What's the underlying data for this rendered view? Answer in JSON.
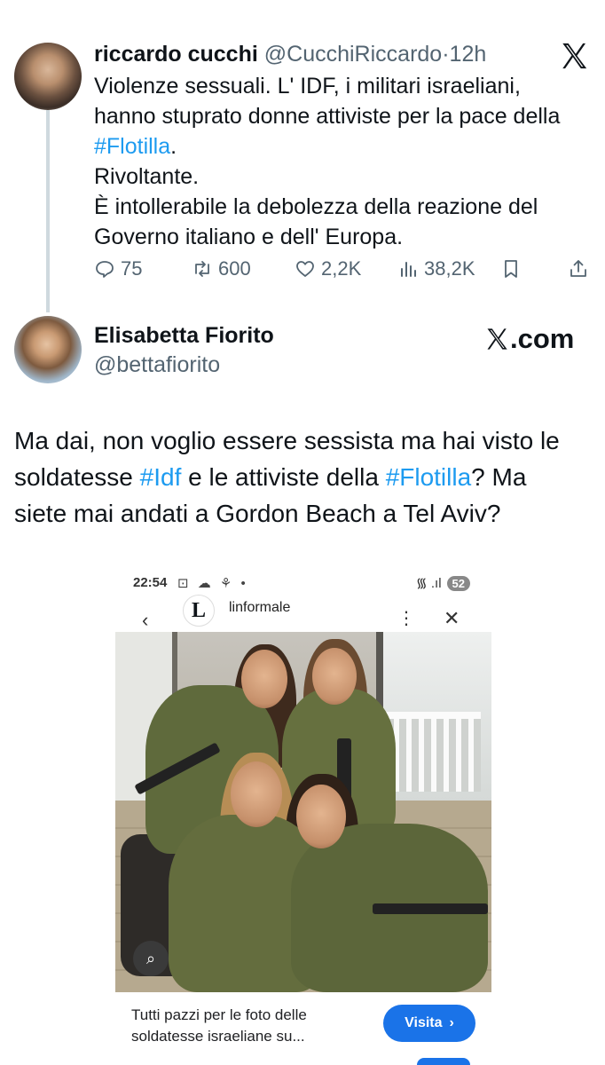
{
  "tweet1": {
    "name": "riccardo cucchi",
    "handle": "@CucchiRiccardo",
    "separator": "·",
    "time": "12h",
    "lines": [
      "Violenze sessuali. L' IDF, i militari israeliani,",
      "hanno stuprato donne attiviste per la pace della",
      "#Flotilla",
      ".",
      "Rivoltante.",
      "È intollerabile la debolezza della reazione del",
      "Governo italiano e dell' Europa."
    ],
    "stats": {
      "replies": "75",
      "reposts": "600",
      "likes": "2,2K",
      "views": "38,2K"
    },
    "icons": [
      "x-logo-icon",
      "reply-icon",
      "repost-icon",
      "like-icon",
      "views-icon",
      "bookmark-icon",
      "share-icon"
    ]
  },
  "tweet2": {
    "name": "Elisabetta Fiorito",
    "handle": "@bettafiorito",
    "brand": ".com",
    "text": {
      "l1": "Ma dai, non voglio essere sessista ma hai visto le",
      "l2a": "soldatesse ",
      "l2tag1": "#Idf",
      "l2b": " e le attiviste della ",
      "l2tag2": "#Flotilla",
      "l2c": "? Ma",
      "l3": "siete mai andati a Gordon Beach a Tel Aviv?"
    }
  },
  "embedded_screenshot": {
    "status_time": "22:54",
    "status_icons": "⊡ ☁ ⚘ •",
    "signal": "᯾ .ıl",
    "battery": "52",
    "site_logo_letter": "L",
    "site_name": "linformale",
    "back_glyph": "‹",
    "menu_glyph": "⋮",
    "close_glyph": "✕",
    "lens_glyph": "⌕",
    "caption_lines": [
      "Tutti pazzi per le foto delle",
      "soldatesse israeliane su..."
    ],
    "visit_label": "Visita",
    "visit_chevron": "›"
  },
  "colors": {
    "link": "#1d9bf0",
    "text": "#0f1419",
    "secondary": "#536471",
    "button_blue": "#1a73e8"
  }
}
